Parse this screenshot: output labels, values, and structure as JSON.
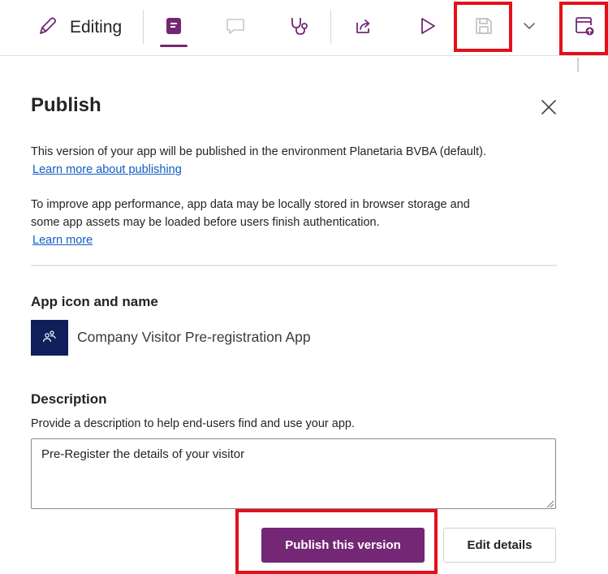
{
  "toolbar": {
    "editing_label": "Editing",
    "icons": [
      "pencil-icon",
      "app-designer-icon",
      "comment-icon",
      "stethoscope-icon",
      "share-icon",
      "play-icon",
      "save-icon",
      "chevron-down-icon",
      "publish-icon"
    ]
  },
  "colors": {
    "accent": "#742774",
    "highlight": "#e3101a",
    "link": "#0f5dc4",
    "app_icon_bg": "#0f1f5a"
  },
  "panel": {
    "title": "Publish",
    "intro_text": "This version of your app will be published in the environment Planetaria BVBA (default).",
    "intro_link": "Learn more about publishing",
    "performance_text_1": "To improve app performance, app data may be locally stored in browser storage and",
    "performance_text_2": "some app assets may be loaded before users finish authentication.",
    "performance_link": "Learn more",
    "app_section_heading": "App icon and name",
    "app_name": "Company Visitor Pre-registration App",
    "description_heading": "Description",
    "description_hint": "Provide a description to help end-users find and use your app.",
    "description_value": "Pre-Register the details of your visitor",
    "publish_button": "Publish this version",
    "edit_button": "Edit details"
  }
}
